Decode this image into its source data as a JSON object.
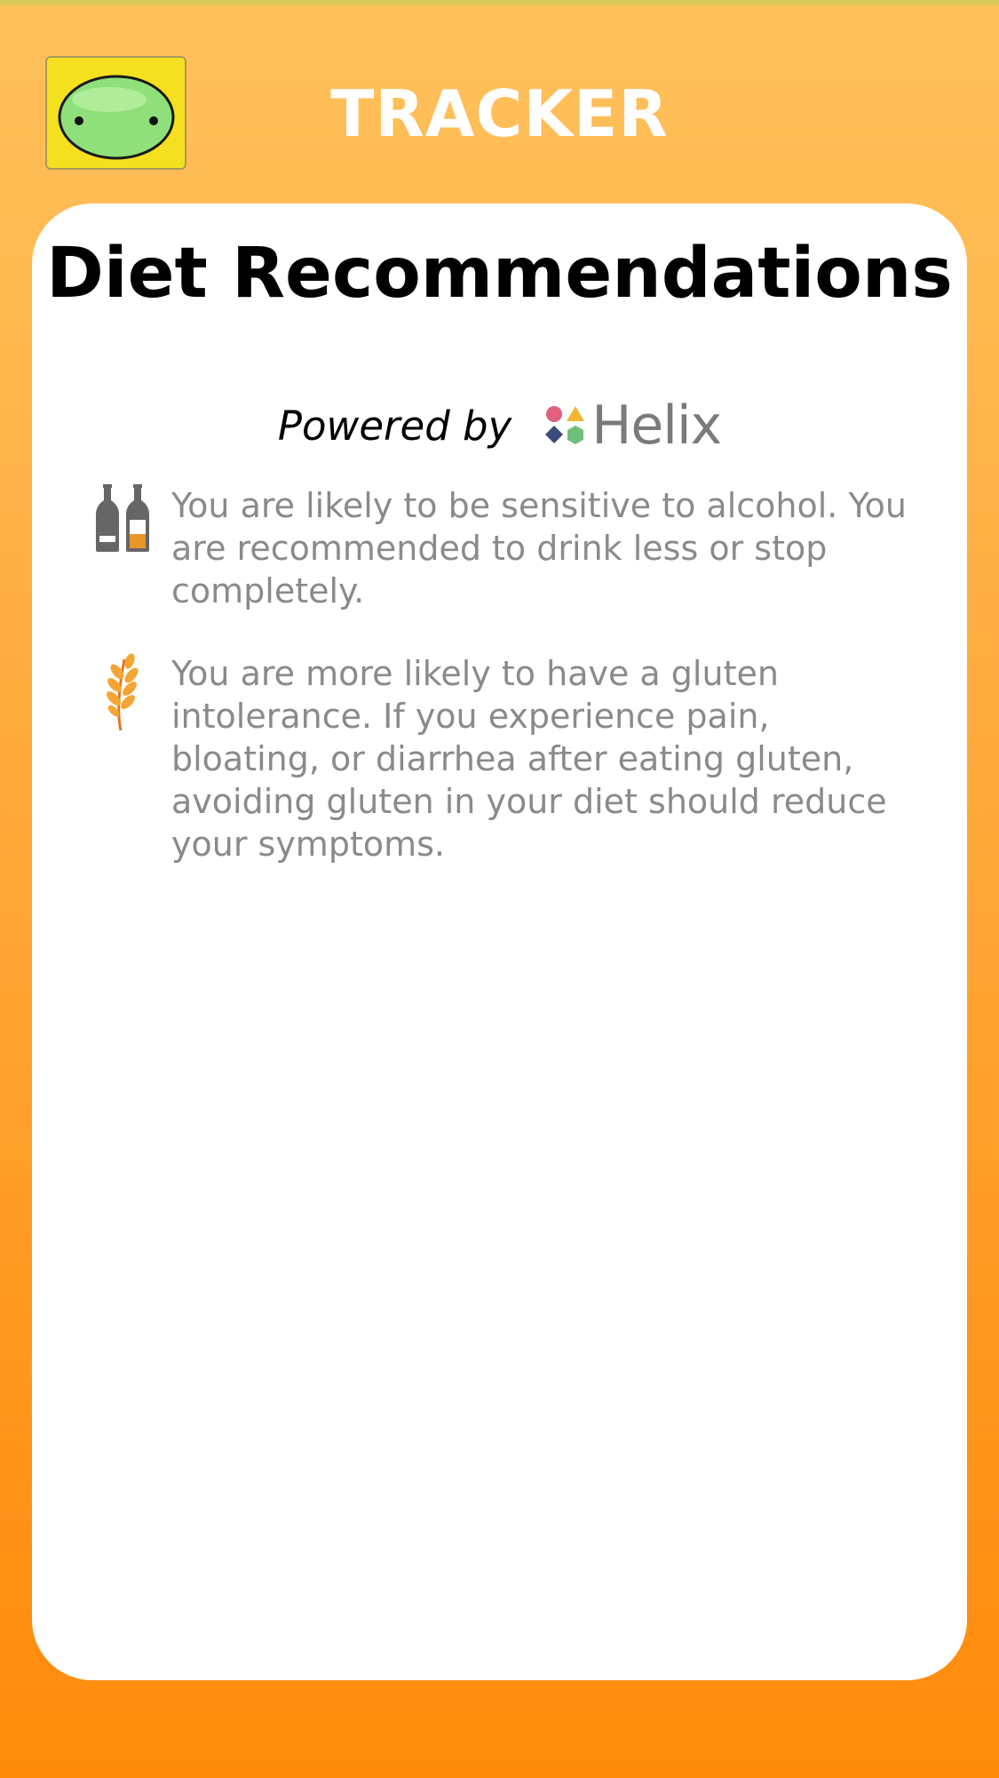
{
  "header": {
    "title": "TRACKER",
    "avatar_icon": "green-blob-icon",
    "colors": {
      "background_top": "#ffc15c",
      "background_bottom": "#ff8a0a",
      "avatar_bg": "#f5e020"
    }
  },
  "card": {
    "title": "Diet Recommendations",
    "powered_by_label": "Powered by",
    "brand_name": "Helix",
    "recommendations": [
      {
        "icon": "wine-bottles-icon",
        "text": "You are likely to be sensitive to alcohol. You are recommended to drink less or stop completely."
      },
      {
        "icon": "wheat-icon",
        "text": "You are more likely to have a gluten intolerance. If you experience pain, bloating, or diarrhea after eating gluten, avoiding gluten in your diet should reduce your symptoms."
      }
    ]
  }
}
